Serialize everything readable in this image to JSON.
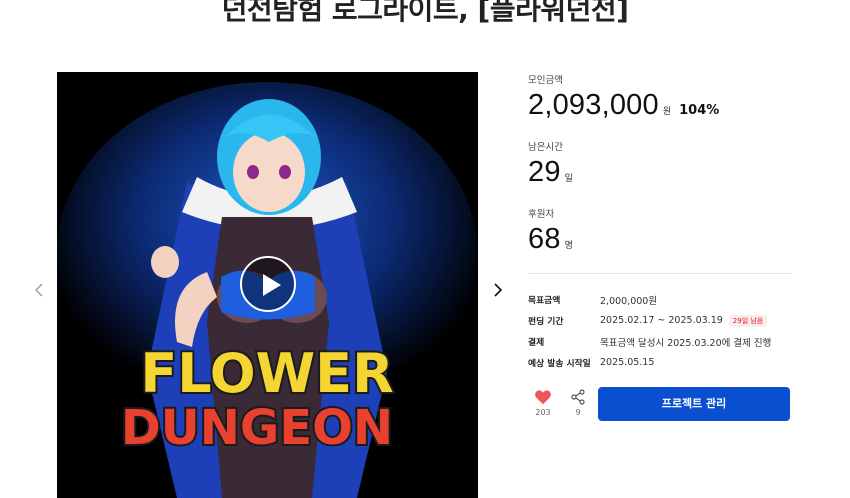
{
  "project": {
    "title": "던전탐험 로그라이트, [플라워던전]"
  },
  "media": {
    "logo_line1": "FLOWER",
    "logo_line2": "DUNGEON"
  },
  "stats": {
    "funded_label": "모인금액",
    "funded_value": "2,093,000",
    "funded_unit": "원",
    "funded_percent": "104%",
    "time_label": "남은시간",
    "time_value": "29",
    "time_unit": "일",
    "backers_label": "후원자",
    "backers_value": "68",
    "backers_unit": "명"
  },
  "info": [
    {
      "key": "목표금액",
      "value": "2,000,000원"
    },
    {
      "key": "펀딩 기간",
      "value": "2025.02.17 ~ 2025.03.19",
      "badge": "29일 남음"
    },
    {
      "key": "결제",
      "value": "목표금액 달성시 2025.03.20에 결제 진행"
    },
    {
      "key": "예상 발송 시작일",
      "value": "2025.05.15"
    }
  ],
  "actions": {
    "like_count": "203",
    "share_count": "9",
    "manage_label": "프로젝트 관리"
  },
  "colors": {
    "accent": "#0b4fd1",
    "heart": "#f05454",
    "badge_text": "#e0202b",
    "badge_bg": "#fdecec"
  }
}
